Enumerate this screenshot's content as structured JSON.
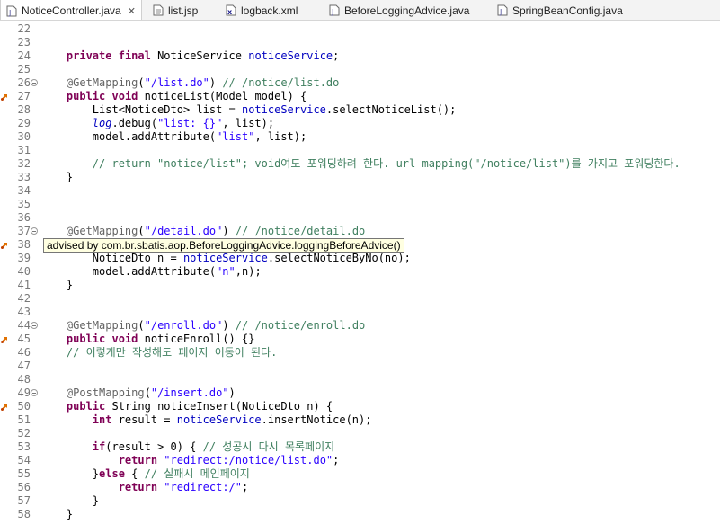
{
  "tabs": [
    {
      "label": "NoticeController.java",
      "icon": "java-file-icon",
      "active": true,
      "close": "✕"
    },
    {
      "label": "list.jsp",
      "icon": "jsp-file-icon",
      "active": false
    },
    {
      "label": "logback.xml",
      "icon": "xml-file-icon",
      "active": false
    },
    {
      "label": "BeforeLoggingAdvice.java",
      "icon": "java-file-icon",
      "active": false
    },
    {
      "label": "SpringBeanConfig.java",
      "icon": "java-file-icon",
      "active": false
    }
  ],
  "tooltip": "advised by com.br.sbatis.aop.BeforeLoggingAdvice.loggingBeforeAdvice()",
  "colors": {
    "keyword": "#7f0055",
    "annotation": "#646464",
    "string": "#2a00ff",
    "comment": "#3f7f5f",
    "field": "#0000c0"
  },
  "lines": [
    {
      "n": "22",
      "fold": false,
      "advice": false,
      "segs": []
    },
    {
      "n": "23",
      "fold": false,
      "advice": false,
      "segs": []
    },
    {
      "n": "24",
      "fold": false,
      "advice": false,
      "segs": [
        {
          "t": "    "
        },
        {
          "t": "private",
          "c": "k"
        },
        {
          "t": " "
        },
        {
          "t": "final",
          "c": "k"
        },
        {
          "t": " NoticeService "
        },
        {
          "t": "noticeService",
          "c": "f"
        },
        {
          "t": ";"
        }
      ]
    },
    {
      "n": "25",
      "fold": false,
      "advice": false,
      "segs": []
    },
    {
      "n": "26",
      "fold": true,
      "advice": false,
      "segs": [
        {
          "t": "    "
        },
        {
          "t": "@GetMapping",
          "c": "a"
        },
        {
          "t": "("
        },
        {
          "t": "\"/list.do\"",
          "c": "s"
        },
        {
          "t": ") "
        },
        {
          "t": "// /notice/list.do",
          "c": "c"
        }
      ]
    },
    {
      "n": "27",
      "fold": false,
      "advice": true,
      "segs": [
        {
          "t": "    "
        },
        {
          "t": "public",
          "c": "k"
        },
        {
          "t": " "
        },
        {
          "t": "void",
          "c": "k"
        },
        {
          "t": " noticeList(Model model) {"
        }
      ]
    },
    {
      "n": "28",
      "fold": false,
      "advice": false,
      "segs": [
        {
          "t": "        List<NoticeDto> list = "
        },
        {
          "t": "noticeService",
          "c": "f"
        },
        {
          "t": ".selectNoticeList();"
        }
      ]
    },
    {
      "n": "29",
      "fold": false,
      "advice": false,
      "segs": [
        {
          "t": "        "
        },
        {
          "t": "log",
          "c": "f i"
        },
        {
          "t": ".debug("
        },
        {
          "t": "\"list: {}\"",
          "c": "s"
        },
        {
          "t": ", list);"
        }
      ]
    },
    {
      "n": "30",
      "fold": false,
      "advice": false,
      "segs": [
        {
          "t": "        model.addAttribute("
        },
        {
          "t": "\"list\"",
          "c": "s"
        },
        {
          "t": ", list);"
        }
      ]
    },
    {
      "n": "31",
      "fold": false,
      "advice": false,
      "segs": []
    },
    {
      "n": "32",
      "fold": false,
      "advice": false,
      "segs": [
        {
          "t": "        "
        },
        {
          "t": "// return \"notice/list\"; void여도 포워딩하려 한다. url mapping(\"/notice/list\")를 가지고 포워딩한다.",
          "c": "c"
        }
      ]
    },
    {
      "n": "33",
      "fold": false,
      "advice": false,
      "segs": [
        {
          "t": "    }"
        }
      ]
    },
    {
      "n": "34",
      "fold": false,
      "advice": false,
      "segs": []
    },
    {
      "n": "35",
      "fold": false,
      "advice": false,
      "segs": []
    },
    {
      "n": "36",
      "fold": false,
      "advice": false,
      "segs": []
    },
    {
      "n": "37",
      "fold": true,
      "advice": false,
      "segs": [
        {
          "t": "    "
        },
        {
          "t": "@GetMapping",
          "c": "a"
        },
        {
          "t": "("
        },
        {
          "t": "\"/detail.do\"",
          "c": "s"
        },
        {
          "t": ") "
        },
        {
          "t": "// /notice/detail.do",
          "c": "c"
        }
      ]
    },
    {
      "n": "38",
      "fold": false,
      "advice": true,
      "segs": []
    },
    {
      "n": "39",
      "fold": false,
      "advice": false,
      "segs": [
        {
          "t": "        NoticeDto n = "
        },
        {
          "t": "noticeService",
          "c": "f"
        },
        {
          "t": ".selectNoticeByNo(no);"
        }
      ]
    },
    {
      "n": "40",
      "fold": false,
      "advice": false,
      "segs": [
        {
          "t": "        model.addAttribute("
        },
        {
          "t": "\"n\"",
          "c": "s"
        },
        {
          "t": ",n);"
        }
      ]
    },
    {
      "n": "41",
      "fold": false,
      "advice": false,
      "segs": [
        {
          "t": "    }"
        }
      ]
    },
    {
      "n": "42",
      "fold": false,
      "advice": false,
      "segs": []
    },
    {
      "n": "43",
      "fold": false,
      "advice": false,
      "segs": []
    },
    {
      "n": "44",
      "fold": true,
      "advice": false,
      "segs": [
        {
          "t": "    "
        },
        {
          "t": "@GetMapping",
          "c": "a"
        },
        {
          "t": "("
        },
        {
          "t": "\"/enroll.do\"",
          "c": "s"
        },
        {
          "t": ") "
        },
        {
          "t": "// /notice/enroll.do",
          "c": "c"
        }
      ]
    },
    {
      "n": "45",
      "fold": false,
      "advice": true,
      "segs": [
        {
          "t": "    "
        },
        {
          "t": "public",
          "c": "k"
        },
        {
          "t": " "
        },
        {
          "t": "void",
          "c": "k"
        },
        {
          "t": " noticeEnroll() {}"
        }
      ]
    },
    {
      "n": "46",
      "fold": false,
      "advice": false,
      "segs": [
        {
          "t": "    "
        },
        {
          "t": "// 이렇게만 작성해도 페이지 이동이 된다.",
          "c": "c"
        }
      ]
    },
    {
      "n": "47",
      "fold": false,
      "advice": false,
      "segs": []
    },
    {
      "n": "48",
      "fold": false,
      "advice": false,
      "segs": []
    },
    {
      "n": "49",
      "fold": true,
      "advice": false,
      "segs": [
        {
          "t": "    "
        },
        {
          "t": "@PostMapping",
          "c": "a"
        },
        {
          "t": "("
        },
        {
          "t": "\"/insert.do\"",
          "c": "s"
        },
        {
          "t": ")"
        }
      ]
    },
    {
      "n": "50",
      "fold": false,
      "advice": true,
      "segs": [
        {
          "t": "    "
        },
        {
          "t": "public",
          "c": "k"
        },
        {
          "t": " String noticeInsert(NoticeDto n) {"
        }
      ]
    },
    {
      "n": "51",
      "fold": false,
      "advice": false,
      "segs": [
        {
          "t": "        "
        },
        {
          "t": "int",
          "c": "k"
        },
        {
          "t": " result = "
        },
        {
          "t": "noticeService",
          "c": "f"
        },
        {
          "t": ".insertNotice(n);"
        }
      ]
    },
    {
      "n": "52",
      "fold": false,
      "advice": false,
      "segs": []
    },
    {
      "n": "53",
      "fold": false,
      "advice": false,
      "segs": [
        {
          "t": "        "
        },
        {
          "t": "if",
          "c": "k"
        },
        {
          "t": "(result > 0) { "
        },
        {
          "t": "// 성공시 다시 목록페이지",
          "c": "c"
        }
      ]
    },
    {
      "n": "54",
      "fold": false,
      "advice": false,
      "segs": [
        {
          "t": "            "
        },
        {
          "t": "return",
          "c": "k"
        },
        {
          "t": " "
        },
        {
          "t": "\"redirect:/notice/list.do\"",
          "c": "s"
        },
        {
          "t": ";"
        }
      ]
    },
    {
      "n": "55",
      "fold": false,
      "advice": false,
      "segs": [
        {
          "t": "        }"
        },
        {
          "t": "else",
          "c": "k"
        },
        {
          "t": " { "
        },
        {
          "t": "// 실패시 메인페이지",
          "c": "c"
        }
      ]
    },
    {
      "n": "56",
      "fold": false,
      "advice": false,
      "segs": [
        {
          "t": "            "
        },
        {
          "t": "return",
          "c": "k"
        },
        {
          "t": " "
        },
        {
          "t": "\"redirect:/\"",
          "c": "s"
        },
        {
          "t": ";"
        }
      ]
    },
    {
      "n": "57",
      "fold": false,
      "advice": false,
      "segs": [
        {
          "t": "        }"
        }
      ]
    },
    {
      "n": "58",
      "fold": false,
      "advice": false,
      "segs": [
        {
          "t": "    }"
        }
      ]
    }
  ]
}
